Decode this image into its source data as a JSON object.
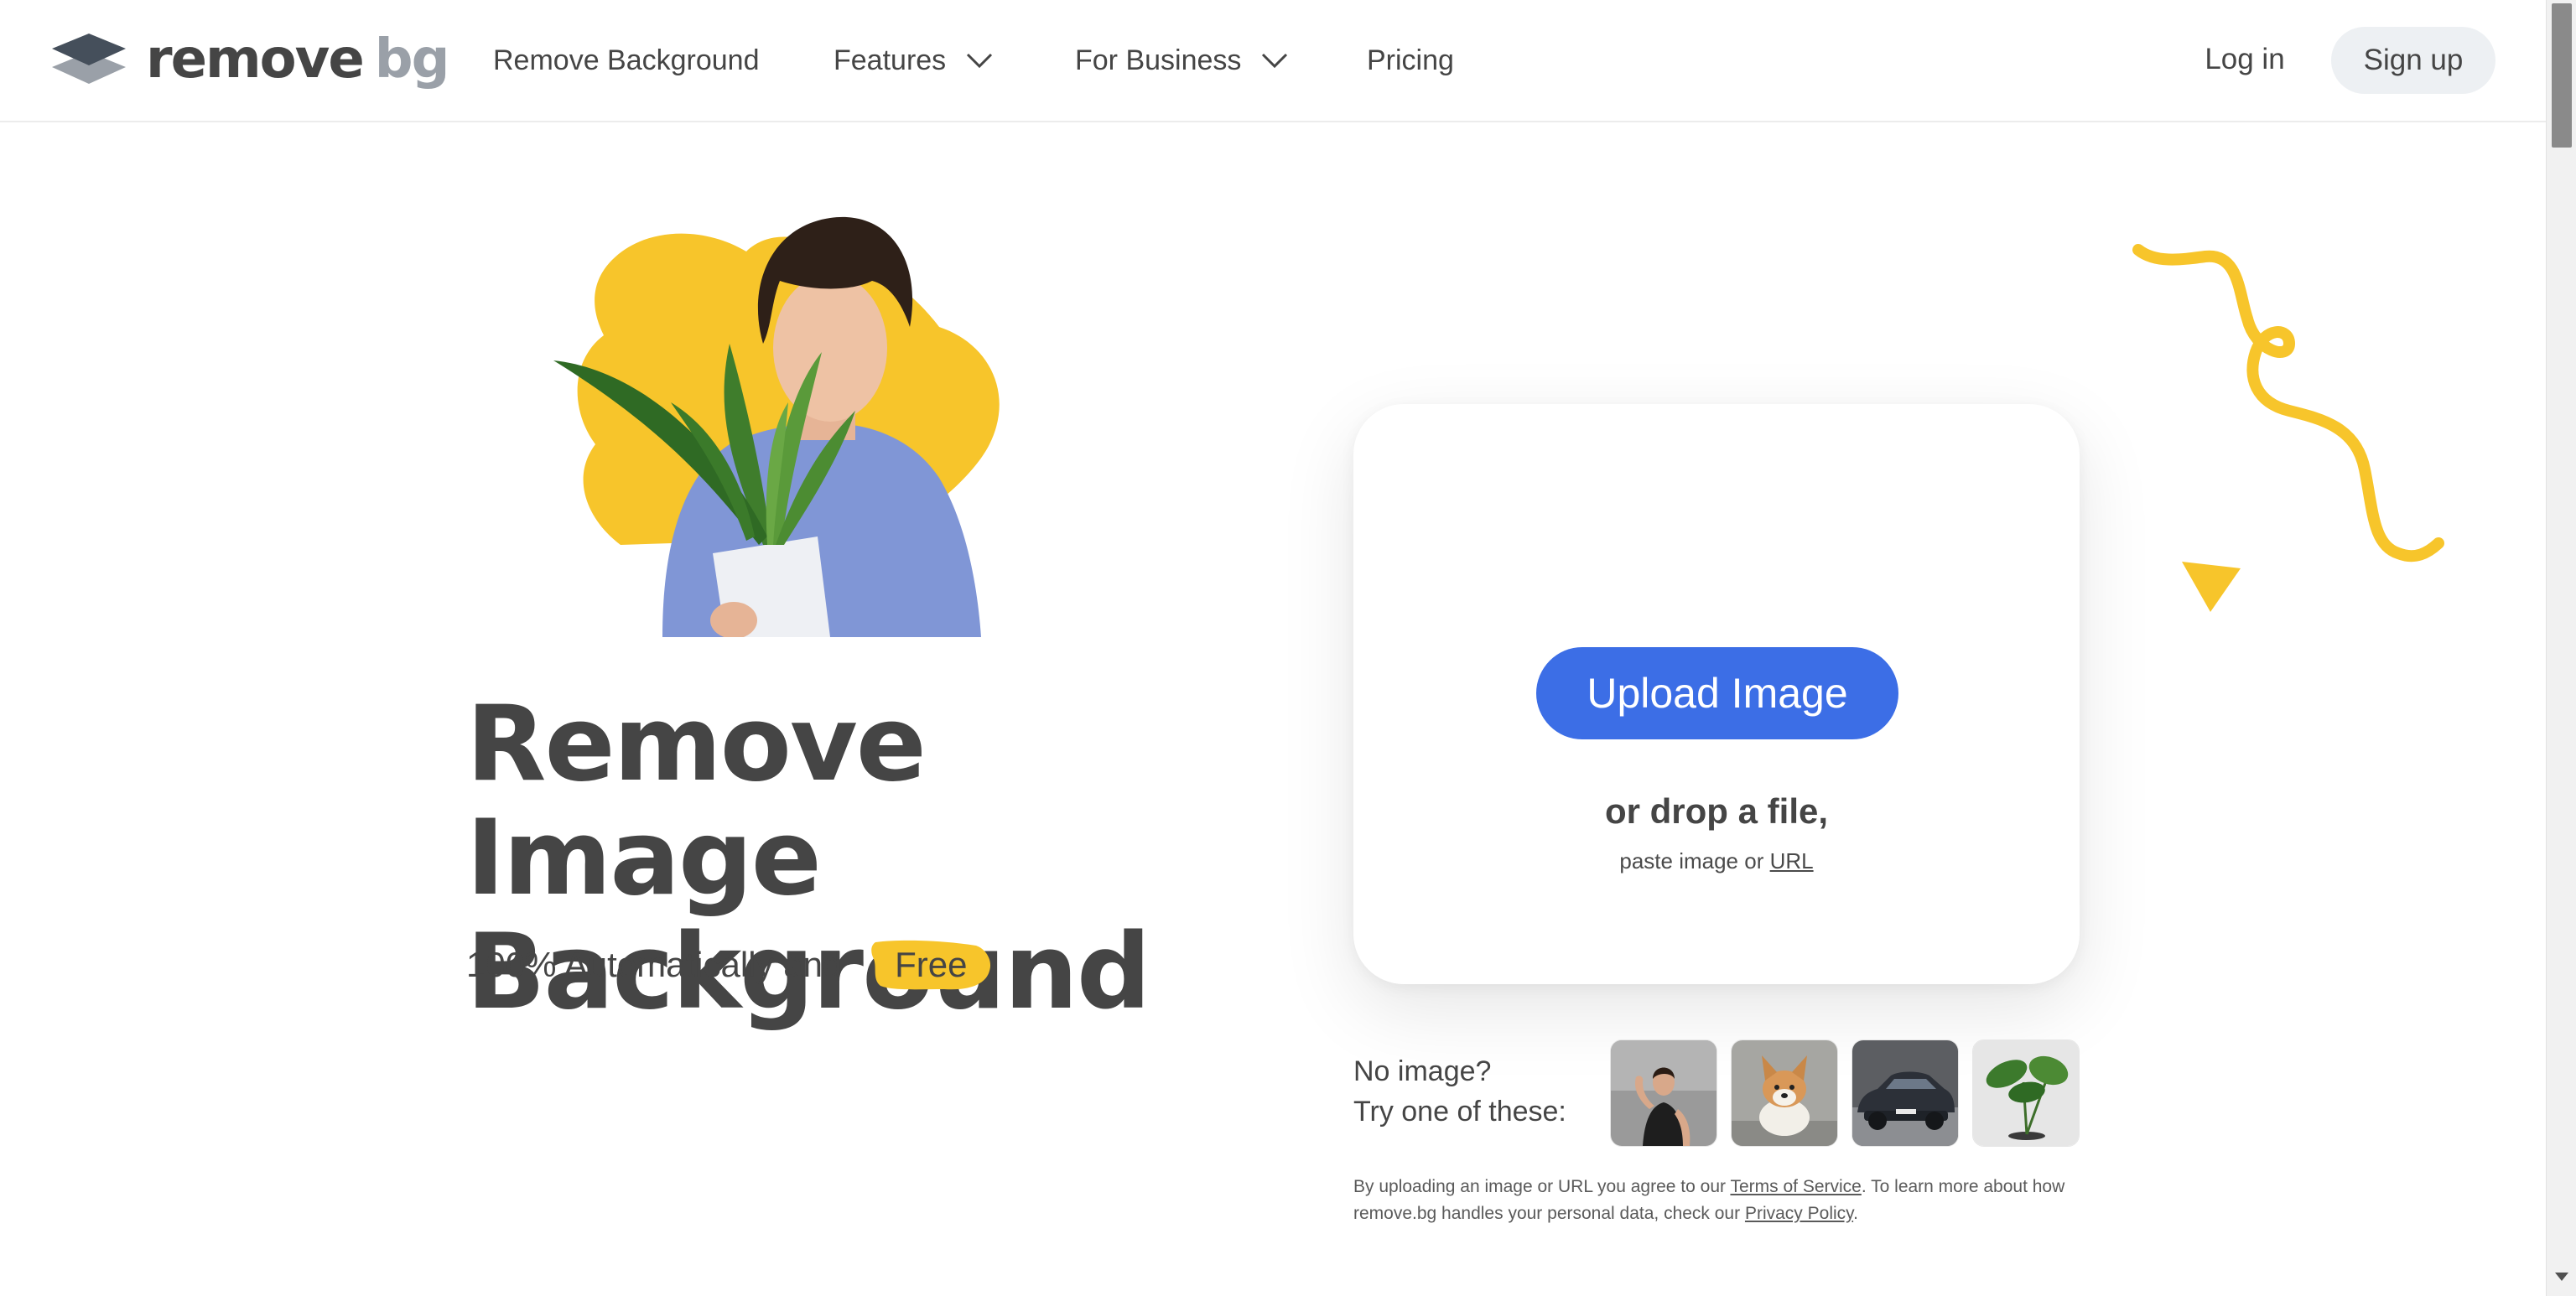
{
  "brand": {
    "word1": "remove",
    "word2": "bg",
    "icon": "stacked-layers-logo-icon"
  },
  "nav": {
    "items": [
      {
        "label": "Remove Background",
        "dropdown": false
      },
      {
        "label": "Features",
        "dropdown": true
      },
      {
        "label": "For Business",
        "dropdown": true
      },
      {
        "label": "Pricing",
        "dropdown": false
      }
    ],
    "login": "Log in",
    "signup": "Sign up"
  },
  "hero": {
    "title_line1": "Remove Image",
    "title_line2": "Background",
    "subtitle": "100% Automatically and",
    "badge": "Free"
  },
  "upload": {
    "button": "Upload Image",
    "drop": "or drop a file,",
    "paste_prefix": "paste image or",
    "paste_link": "URL"
  },
  "samples": {
    "line1": "No image?",
    "line2": "Try one of these:",
    "items": [
      "sample-woman-photo",
      "sample-dog-photo",
      "sample-car-photo",
      "sample-plant-photo"
    ]
  },
  "disclaimer": {
    "p1": "By uploading an image or URL you agree to our",
    "tos": "Terms of Service",
    "p2": ". To learn more about how remove.bg handles your personal data, check our",
    "privacy": "Privacy Policy",
    "p3": "."
  },
  "colors": {
    "accent": "#3c6ee6",
    "yellow": "#f7c52b",
    "text": "#454545"
  }
}
